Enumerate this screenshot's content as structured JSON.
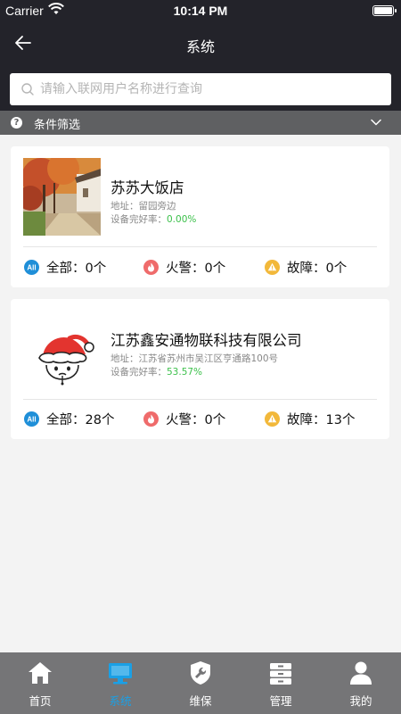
{
  "status_bar": {
    "carrier": "Carrier",
    "time": "10:14 PM"
  },
  "nav": {
    "title": "系统"
  },
  "search": {
    "placeholder": "请输入联网用户名称进行查询",
    "value": ""
  },
  "filter": {
    "label": "条件筛选"
  },
  "cards": [
    {
      "name": "苏苏大饭店",
      "address": "地址：留园旁边",
      "rate_label": "设备完好率：",
      "rate_value": "0.00%",
      "stats": {
        "all": "全部：0个",
        "fire": "火警：0个",
        "fault": "故障：0个"
      }
    },
    {
      "name": "江苏鑫安通物联科技有限公司",
      "address": "地址：江苏省苏州市吴江区亨通路100号",
      "rate_label": "设备完好率：",
      "rate_value": "53.57%",
      "stats": {
        "all": "全部：28个",
        "fire": "火警：0个",
        "fault": "故障：13个"
      }
    }
  ],
  "stat_icons": {
    "all_badge": "All"
  },
  "tabs": [
    {
      "label": "首页",
      "icon": "home-icon",
      "active": false
    },
    {
      "label": "系统",
      "icon": "monitor-icon",
      "active": true
    },
    {
      "label": "维保",
      "icon": "shield-wrench-icon",
      "active": false
    },
    {
      "label": "管理",
      "icon": "storage-box-icon",
      "active": false
    },
    {
      "label": "我的",
      "icon": "person-icon",
      "active": false
    }
  ],
  "colors": {
    "header_bg": "#23232a",
    "filter_bg": "#5f6062",
    "tab_bar_bg": "#757577",
    "active_tab": "#1aa0e6",
    "rate_green": "#3cc04b",
    "all_blue": "#1f8fd8",
    "fire_red": "#ef6b6b",
    "fault_yellow": "#f2b83a"
  }
}
